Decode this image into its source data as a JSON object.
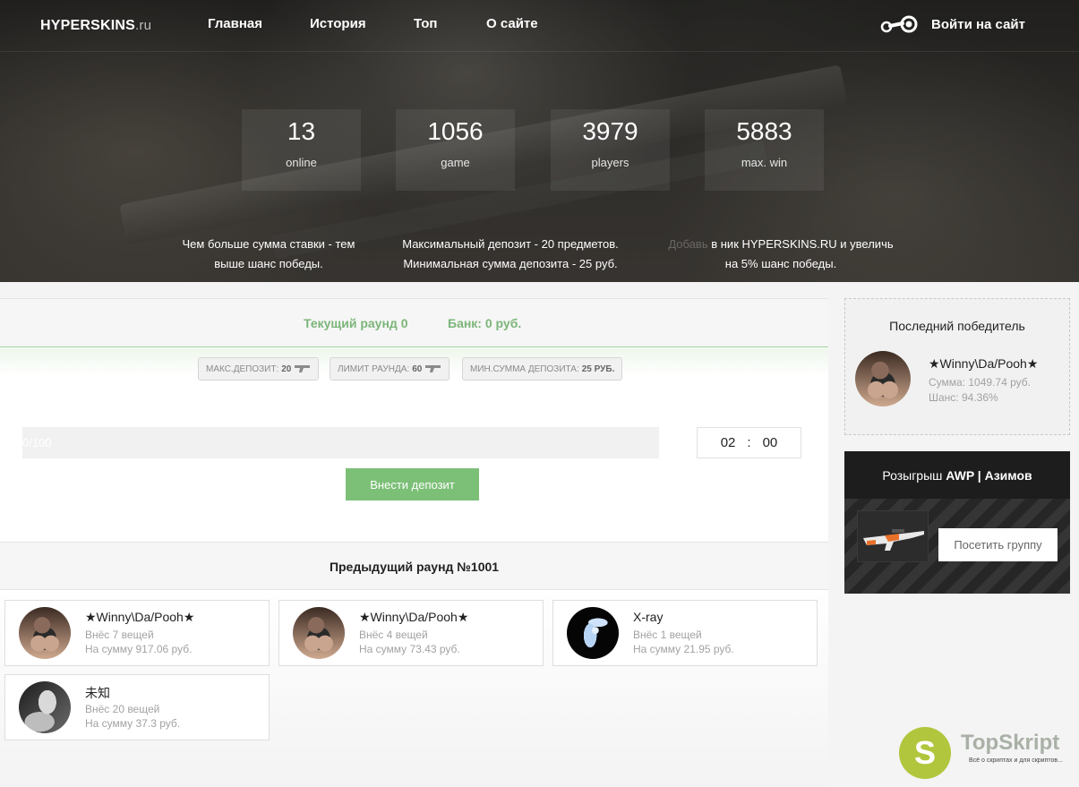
{
  "nav": {
    "logo_main": "HYPERSKINS",
    "logo_suffix": ".ru",
    "items": [
      "Главная",
      "История",
      "Топ",
      "О сайте"
    ],
    "login": "Войти на сайт"
  },
  "stats": [
    {
      "value": "13",
      "label": "online"
    },
    {
      "value": "1056",
      "label": "game"
    },
    {
      "value": "3979",
      "label": "players"
    },
    {
      "value": "5883",
      "label": "max. win"
    }
  ],
  "info": {
    "col1": [
      "Чем больше сумма ставки - тем",
      "выше шанс победы."
    ],
    "col2": [
      "Максимальный депозит - 20 предметов.",
      "Минимальная сумма депозита - 25 руб."
    ],
    "col3_faded": "Добавь",
    "col3": [
      "в ник HYPERSKINS.RU и увеличь",
      "на 5% шанс победы."
    ]
  },
  "round": {
    "current": "Текущий раунд 0",
    "bank": "Банк: 0 руб.",
    "pills": [
      {
        "label": "МАКС.ДЕПОЗИТ:",
        "value": "20"
      },
      {
        "label": "ЛИМИТ РАУНДА:",
        "value": "60"
      },
      {
        "label": "МИН.СУММА ДЕПОЗИТА:",
        "value": "25 РУБ."
      }
    ],
    "progress_text": "0/100",
    "progress_fraction": 0,
    "timer_min": "02",
    "timer_sep": ":",
    "timer_sec": "00",
    "deposit_button": "Внести депозит"
  },
  "previous": {
    "title": "Предыдущий раунд №1001",
    "players": [
      {
        "name": "★Winny\\Da/Pooh★",
        "items": "Внёс 7 вещей",
        "sum": "На сумму 917.06 руб.",
        "avatar": "girl-avatar"
      },
      {
        "name": "★Winny\\Da/Pooh★",
        "items": "Внёс 4 вещей",
        "sum": "На сумму 73.43 руб.",
        "avatar": "girl-avatar"
      },
      {
        "name": "X-ray",
        "items": "Внёс 1 вещей",
        "sum": "На сумму 21.95 руб.",
        "avatar": "xray-avatar"
      },
      {
        "name": "未知",
        "items": "Внёс 20 вещей",
        "sum": "На сумму 37.3 руб.",
        "avatar": "bw-avatar"
      }
    ]
  },
  "winner": {
    "title": "Последний победитель",
    "name": "★Winny\\Da/Pooh★",
    "sum": "Сумма: 1049.74 руб.",
    "chance": "Шанс: 94.36%"
  },
  "giveaway": {
    "prefix": "Розыгрыш ",
    "item": "AWP | Азимов",
    "button": "Посетить группу"
  },
  "watermark": {
    "letter": "S",
    "brand": "TopSkript",
    "tagline": "Всё о скриптах и для скриптов..."
  },
  "colors": {
    "accent_green": "#7cc077",
    "header_green_text": "#7cb579",
    "watermark_green": "#b1c63c"
  }
}
